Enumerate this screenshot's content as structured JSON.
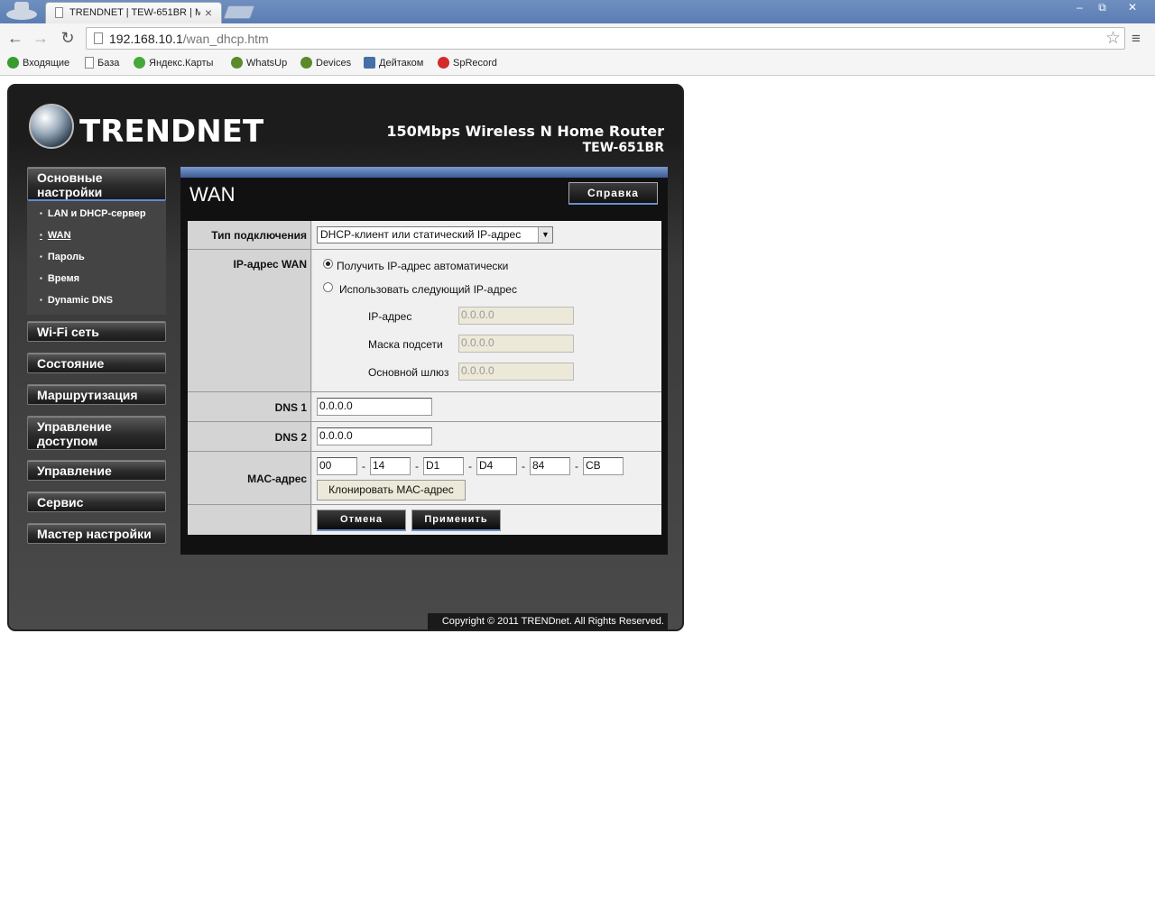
{
  "browser": {
    "tab_title": "TRENDNET | TEW-651BR | M",
    "tab_close": "×",
    "url_host": "192.168.10.1",
    "url_path": "/wan_dhcp.htm",
    "window_controls": {
      "minimize": "‒",
      "maximize": "⧉",
      "close": "✕"
    },
    "bookmarks": [
      {
        "label": "Входящие",
        "icon": "phone-icon",
        "color": "#3a9b2f"
      },
      {
        "label": "База",
        "icon": "page-icon",
        "color": "#ffffff"
      },
      {
        "label": "Яндекс.Карты",
        "icon": "map-icon",
        "color": "#46a83a"
      },
      {
        "label": "WhatsUp",
        "icon": "eye-icon",
        "color": "#5a8a2a"
      },
      {
        "label": "Devices",
        "icon": "eye-icon",
        "color": "#5a8a2a"
      },
      {
        "label": "Дейтаком",
        "icon": "d-icon",
        "color": "#4470a8"
      },
      {
        "label": "SpRecord",
        "icon": "sp-icon",
        "color": "#d32a2a"
      }
    ]
  },
  "router": {
    "brand": "TRENDNET",
    "product_line1": "150Mbps Wireless N Home Router",
    "product_line2": "TEW-651BR",
    "copyright": "Copyright © 2011 TRENDnet. All Rights Reserved.",
    "sidebar": {
      "sections": [
        {
          "label": "Основные настройки"
        },
        {
          "label": "Wi-Fi сеть"
        },
        {
          "label": "Состояние"
        },
        {
          "label": "Маршрутизация"
        },
        {
          "label": "Управление доступом"
        },
        {
          "label": "Управление"
        },
        {
          "label": "Сервис"
        },
        {
          "label": "Мастер настройки"
        }
      ],
      "sub_items": [
        {
          "label": "LAN и DHCP-сервер"
        },
        {
          "label": "WAN"
        },
        {
          "label": "Пароль"
        },
        {
          "label": "Время"
        },
        {
          "label": "Dynamic DNS"
        }
      ]
    },
    "panel": {
      "title": "WAN",
      "help_label": "Справка",
      "connection_type_label": "Тип подключения",
      "connection_type_value": "DHCP-клиент или статический IP-адрес",
      "wan_ip_label": "IP-адрес WAN",
      "radio_auto": "Получить IP-адрес автоматически",
      "radio_manual": "Использовать следующий IP-адрес",
      "ip_label": "IP-адрес",
      "ip_value": "0.0.0.0",
      "mask_label": "Маска подсети",
      "mask_value": "0.0.0.0",
      "gateway_label": "Основной шлюз",
      "gateway_value": "0.0.0.0",
      "dns1_label": "DNS 1",
      "dns1_value": "0.0.0.0",
      "dns2_label": "DNS 2",
      "dns2_value": "0.0.0.0",
      "mac_label": "МАС-адрес",
      "mac_octets": [
        "00",
        "14",
        "D1",
        "D4",
        "84",
        "CB"
      ],
      "mac_sep": "-",
      "clone_mac_label": "Клонировать МАС-адрес",
      "cancel_label": "Отмена",
      "apply_label": "Применить"
    }
  }
}
